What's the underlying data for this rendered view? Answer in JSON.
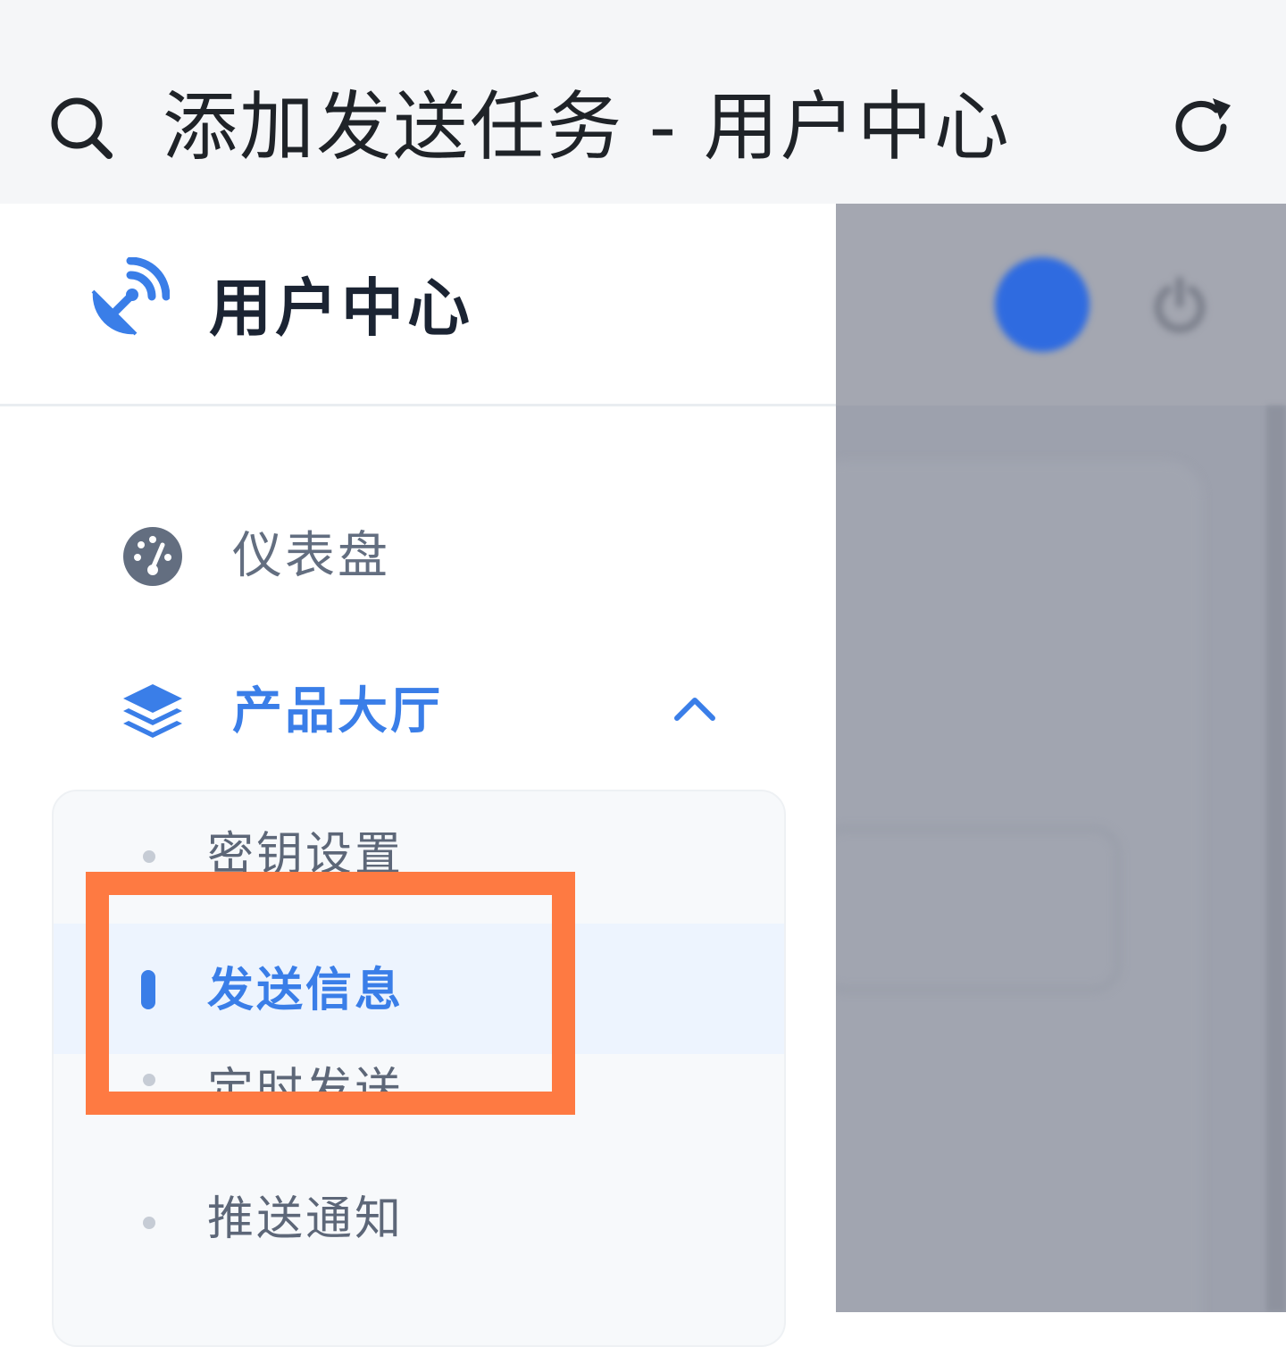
{
  "topbar": {
    "title": "添加发送任务 - 用户中心",
    "search_icon": "search-icon",
    "reload_icon": "reload-icon"
  },
  "brand": {
    "name": "用户中心",
    "logo_icon": "satellite-dish-icon",
    "logo_color": "#3a7ee8"
  },
  "menu": {
    "dashboard": {
      "label": "仪表盘",
      "icon": "dashboard-gauge-icon"
    },
    "products": {
      "label": "产品大厅",
      "icon": "layers-icon",
      "expanded": true
    },
    "submenu": [
      {
        "label": "密钥设置",
        "active": false
      },
      {
        "label": "发送信息",
        "active": true
      },
      {
        "label": "定时发送",
        "active": false
      },
      {
        "label": "推送通知",
        "active": false
      }
    ]
  },
  "colors": {
    "accent": "#3a7ee8",
    "highlight": "#fe7a42",
    "muted_text": "#5d6778",
    "overlay": "#9da1ad"
  }
}
